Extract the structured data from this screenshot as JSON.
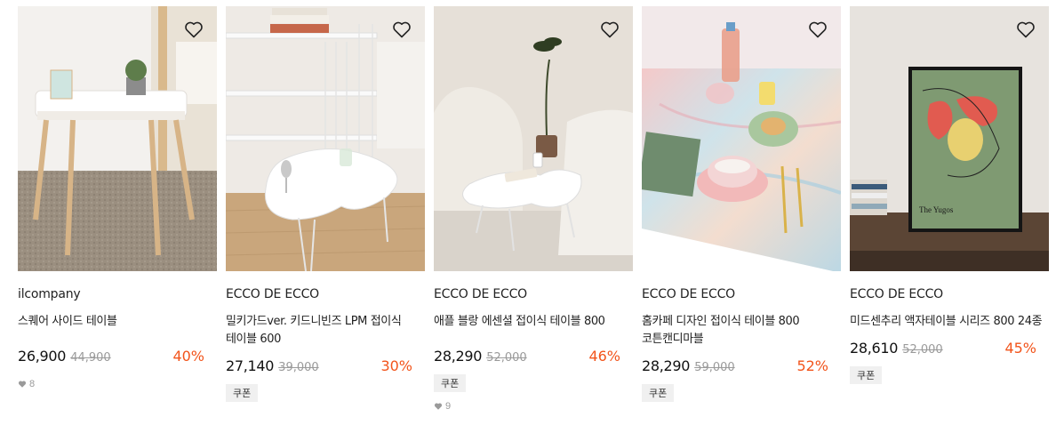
{
  "colors": {
    "discount": "#f2541b",
    "price": "#111111",
    "original_price": "#9a9a9a",
    "coupon_bg": "#f0f0f0"
  },
  "products": [
    {
      "brand": "ilcompany",
      "title": "스퀘어 사이드 테이블",
      "price": "26,900",
      "original_price": "44,900",
      "discount": "40%",
      "coupon": "",
      "likes": "8",
      "wish_icon": "heart-outline-icon"
    },
    {
      "brand": "ECCO DE ECCO",
      "title": "밀키가드ver. 키드니빈즈 LPM 접이식 테이블 600",
      "price": "27,140",
      "original_price": "39,000",
      "discount": "30%",
      "coupon": "쿠폰",
      "likes": "",
      "wish_icon": "heart-outline-icon"
    },
    {
      "brand": "ECCO DE ECCO",
      "title": "애플 블랑 에센셜 접이식 테이블 800",
      "price": "28,290",
      "original_price": "52,000",
      "discount": "46%",
      "coupon": "쿠폰",
      "likes": "9",
      "wish_icon": "heart-outline-icon"
    },
    {
      "brand": "ECCO DE ECCO",
      "title": "홈카페 디자인 접이식 테이블 800 코튼캔디마블",
      "price": "28,290",
      "original_price": "59,000",
      "discount": "52%",
      "coupon": "쿠폰",
      "likes": "",
      "wish_icon": "heart-outline-icon"
    },
    {
      "brand": "ECCO DE ECCO",
      "title": "미드센추리 액자테이블 시리즈 800 24종",
      "price": "28,610",
      "original_price": "52,000",
      "discount": "45%",
      "coupon": "쿠폰",
      "likes": "",
      "wish_icon": "heart-outline-icon",
      "poster_text": "The Yugos"
    }
  ]
}
